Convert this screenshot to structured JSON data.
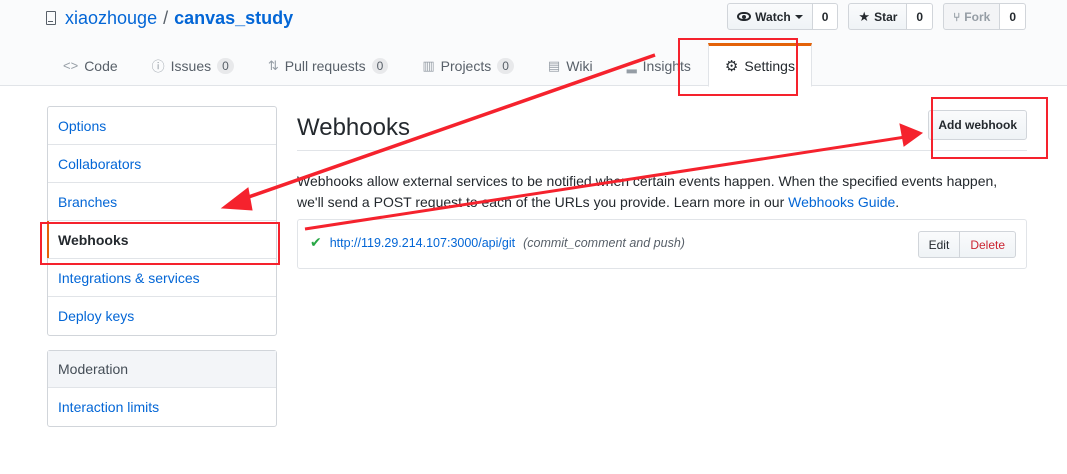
{
  "repo": {
    "owner": "xiaozhouge",
    "separator": "/",
    "name": "canvas_study"
  },
  "actions": {
    "watch": {
      "label": "Watch",
      "count": "0"
    },
    "star": {
      "label": "Star",
      "count": "0"
    },
    "fork": {
      "label": "Fork",
      "count": "0"
    }
  },
  "tabs": [
    {
      "icon": "<>",
      "label": "Code"
    },
    {
      "icon": "ⓘ",
      "label": "Issues",
      "count": "0"
    },
    {
      "icon": "⇅",
      "label": "Pull requests",
      "count": "0"
    },
    {
      "icon": "▥",
      "label": "Projects",
      "count": "0"
    },
    {
      "icon": "▤",
      "label": "Wiki"
    },
    {
      "icon": "▂",
      "label": "Insights"
    },
    {
      "icon": "⚙",
      "label": "Settings"
    }
  ],
  "sidebar": {
    "items": [
      "Options",
      "Collaborators",
      "Branches",
      "Webhooks",
      "Integrations & services",
      "Deploy keys"
    ],
    "moderation": {
      "heading": "Moderation",
      "items": [
        "Interaction limits"
      ]
    }
  },
  "main": {
    "title": "Webhooks",
    "add_button": "Add webhook",
    "description_prefix": "Webhooks allow external services to be notified when certain events happen. When the specified events happen, we'll send a POST request to each of the URLs you provide. Learn more in our ",
    "description_link": "Webhooks Guide",
    "description_suffix": ".",
    "hook": {
      "url": "http://119.29.214.107:3000/api/git",
      "events": "(commit_comment and push)",
      "edit": "Edit",
      "delete": "Delete"
    }
  },
  "colors": {
    "annotation": "#f5222d",
    "link": "#0366d6",
    "tab_accent": "#e36209"
  }
}
